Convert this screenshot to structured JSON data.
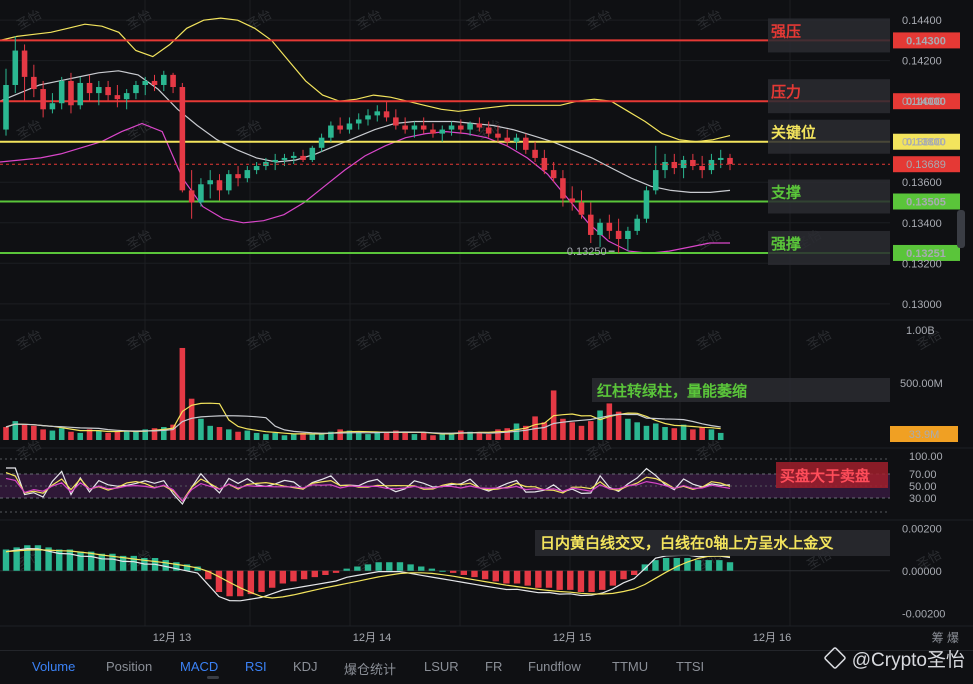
{
  "chart_data": {
    "type": "candlestick",
    "price_axis": {
      "ticks": [
        "0.14400",
        "0.14200",
        "0.14000",
        "0.13800",
        "0.13600",
        "0.13400",
        "0.13200",
        "0.13000"
      ],
      "tick_values": [
        0.144,
        0.142,
        0.14,
        0.138,
        0.136,
        0.134,
        0.132,
        0.13
      ],
      "ylim": [
        0.1293,
        0.1446
      ]
    },
    "x_dates": [
      "12月 13",
      "12月 14",
      "12月 15",
      "12月 16"
    ],
    "ohlc": [
      [
        0.1386,
        0.1416,
        0.1383,
        0.1408
      ],
      [
        0.1408,
        0.1432,
        0.1404,
        0.1425
      ],
      [
        0.1425,
        0.1428,
        0.14,
        0.1412
      ],
      [
        0.1412,
        0.1418,
        0.1402,
        0.1406
      ],
      [
        0.1406,
        0.141,
        0.1392,
        0.1396
      ],
      [
        0.1396,
        0.1404,
        0.1394,
        0.1399
      ],
      [
        0.1399,
        0.1412,
        0.1396,
        0.141
      ],
      [
        0.141,
        0.1414,
        0.1394,
        0.1398
      ],
      [
        0.1398,
        0.1412,
        0.1396,
        0.1409
      ],
      [
        0.1409,
        0.1413,
        0.14,
        0.1404
      ],
      [
        0.1404,
        0.141,
        0.1398,
        0.1407
      ],
      [
        0.1407,
        0.141,
        0.14,
        0.1403
      ],
      [
        0.1403,
        0.1408,
        0.1397,
        0.1401
      ],
      [
        0.1401,
        0.1406,
        0.1396,
        0.1404
      ],
      [
        0.1404,
        0.141,
        0.1401,
        0.1408
      ],
      [
        0.1408,
        0.1412,
        0.1403,
        0.141
      ],
      [
        0.141,
        0.1413,
        0.1405,
        0.1408
      ],
      [
        0.1408,
        0.1415,
        0.1405,
        0.1413
      ],
      [
        0.1413,
        0.1414,
        0.1404,
        0.1407
      ],
      [
        0.1407,
        0.1409,
        0.1355,
        0.1356
      ],
      [
        0.1356,
        0.1366,
        0.1342,
        0.135
      ],
      [
        0.135,
        0.1362,
        0.1348,
        0.1359
      ],
      [
        0.1359,
        0.1366,
        0.1352,
        0.1361
      ],
      [
        0.1361,
        0.1364,
        0.1351,
        0.1356
      ],
      [
        0.1356,
        0.1366,
        0.1354,
        0.1364
      ],
      [
        0.1364,
        0.1368,
        0.1358,
        0.1362
      ],
      [
        0.1362,
        0.1368,
        0.136,
        0.1366
      ],
      [
        0.1366,
        0.137,
        0.1364,
        0.1368
      ],
      [
        0.1368,
        0.1372,
        0.1366,
        0.137
      ],
      [
        0.137,
        0.1374,
        0.1366,
        0.1371
      ],
      [
        0.1371,
        0.1374,
        0.1368,
        0.1372
      ],
      [
        0.1372,
        0.1375,
        0.1369,
        0.1373
      ],
      [
        0.1373,
        0.1376,
        0.137,
        0.1371
      ],
      [
        0.1371,
        0.1378,
        0.137,
        0.1377
      ],
      [
        0.1377,
        0.1384,
        0.1375,
        0.1382
      ],
      [
        0.1382,
        0.139,
        0.138,
        0.1388
      ],
      [
        0.1388,
        0.1392,
        0.1384,
        0.1386
      ],
      [
        0.1386,
        0.1392,
        0.1384,
        0.1389
      ],
      [
        0.1389,
        0.1394,
        0.1386,
        0.1391
      ],
      [
        0.1391,
        0.1396,
        0.1388,
        0.1393
      ],
      [
        0.1393,
        0.1398,
        0.139,
        0.1395
      ],
      [
        0.1395,
        0.14,
        0.139,
        0.1392
      ],
      [
        0.1392,
        0.1396,
        0.1386,
        0.1388
      ],
      [
        0.1388,
        0.1392,
        0.1384,
        0.1386
      ],
      [
        0.1386,
        0.139,
        0.1382,
        0.1388
      ],
      [
        0.1388,
        0.1392,
        0.1384,
        0.1386
      ],
      [
        0.1386,
        0.1389,
        0.1382,
        0.1384
      ],
      [
        0.1384,
        0.1388,
        0.138,
        0.1386
      ],
      [
        0.1386,
        0.139,
        0.1383,
        0.1388
      ],
      [
        0.1388,
        0.1391,
        0.1384,
        0.1386
      ],
      [
        0.1386,
        0.139,
        0.1383,
        0.1389
      ],
      [
        0.1389,
        0.1392,
        0.1385,
        0.1387
      ],
      [
        0.1387,
        0.139,
        0.1382,
        0.1384
      ],
      [
        0.1384,
        0.1388,
        0.138,
        0.1382
      ],
      [
        0.1382,
        0.1386,
        0.1378,
        0.138
      ],
      [
        0.138,
        0.1384,
        0.1376,
        0.1382
      ],
      [
        0.1382,
        0.1384,
        0.1374,
        0.1376
      ],
      [
        0.1376,
        0.138,
        0.137,
        0.1372
      ],
      [
        0.1372,
        0.1376,
        0.1364,
        0.1366
      ],
      [
        0.1366,
        0.137,
        0.136,
        0.1362
      ],
      [
        0.1362,
        0.1366,
        0.1348,
        0.1352
      ],
      [
        0.1352,
        0.1358,
        0.1346,
        0.135
      ],
      [
        0.135,
        0.1356,
        0.1342,
        0.1344
      ],
      [
        0.1344,
        0.135,
        0.133,
        0.1334
      ],
      [
        0.1334,
        0.1342,
        0.1328,
        0.134
      ],
      [
        0.134,
        0.1344,
        0.1332,
        0.1336
      ],
      [
        0.1336,
        0.1342,
        0.1325,
        0.1332
      ],
      [
        0.1332,
        0.1338,
        0.1326,
        0.1336
      ],
      [
        0.1336,
        0.1344,
        0.1334,
        0.1342
      ],
      [
        0.1342,
        0.1358,
        0.134,
        0.1356
      ],
      [
        0.1356,
        0.1378,
        0.1354,
        0.1366
      ],
      [
        0.1366,
        0.1374,
        0.1362,
        0.137
      ],
      [
        0.137,
        0.1374,
        0.1364,
        0.1367
      ],
      [
        0.1367,
        0.1373,
        0.1362,
        0.1371
      ],
      [
        0.1371,
        0.1374,
        0.1366,
        0.1368
      ],
      [
        0.1368,
        0.1373,
        0.1362,
        0.1366
      ],
      [
        0.1366,
        0.1374,
        0.1364,
        0.1371
      ],
      [
        0.1371,
        0.1376,
        0.1367,
        0.1372
      ],
      [
        0.1372,
        0.1374,
        0.1366,
        0.1369
      ]
    ],
    "ma_lines": {
      "upper_band": [
        0.143,
        0.1432,
        0.1433,
        0.1434,
        0.1436,
        0.1438,
        0.1437,
        0.1434,
        0.1425,
        0.1422,
        0.1428,
        0.1436,
        0.144,
        0.1441,
        0.144,
        0.1436,
        0.143,
        0.142,
        0.141,
        0.1403,
        0.14,
        0.1401,
        0.1403,
        0.1402,
        0.14,
        0.1398,
        0.1396,
        0.1395,
        0.1396,
        0.1397,
        0.1398,
        0.1398,
        0.1398,
        0.1398,
        0.14,
        0.1401,
        0.14,
        0.1395,
        0.139,
        0.1384,
        0.1381,
        0.138,
        0.1381,
        0.1383
      ],
      "middle_band": [
        0.14,
        0.1404,
        0.1408,
        0.141,
        0.1412,
        0.1414,
        0.1415,
        0.1413,
        0.1406,
        0.1396,
        0.1388,
        0.1381,
        0.1376,
        0.1372,
        0.137,
        0.1371,
        0.1374,
        0.1378,
        0.1382,
        0.1386,
        0.1389,
        0.139,
        0.139,
        0.139,
        0.1389,
        0.1388,
        0.1386,
        0.1383,
        0.138,
        0.1376,
        0.1372,
        0.1367,
        0.1362,
        0.1358,
        0.1356,
        0.1355,
        0.1355,
        0.1356
      ],
      "lower_band": [
        0.137,
        0.1371,
        0.1372,
        0.1374,
        0.1377,
        0.138,
        0.1385,
        0.1389,
        0.1385,
        0.1362,
        0.1348,
        0.1342,
        0.134,
        0.1341,
        0.1344,
        0.135,
        0.1358,
        0.1366,
        0.1373,
        0.1378,
        0.1382,
        0.1384,
        0.1385,
        0.1384,
        0.1382,
        0.1378,
        0.1372,
        0.1364,
        0.1352,
        0.134,
        0.1331,
        0.1326,
        0.1325,
        0.1326,
        0.1328,
        0.133,
        0.133
      ]
    },
    "levels": [
      {
        "name": "强压",
        "price_label": "0.14300",
        "value": 0.143,
        "color": "#e53935"
      },
      {
        "name": "压力",
        "price_label": "0.14000",
        "value": 0.14,
        "color": "#e53935"
      },
      {
        "name": "关键位",
        "price_label": "0.13800",
        "value": 0.138,
        "color": "#f3e45d"
      },
      {
        "name": "支撑",
        "price_label": "0.13505",
        "value": 0.13505,
        "color": "#5ac53a"
      },
      {
        "name": "强撑",
        "price_label": "0.13251",
        "value": 0.13251,
        "color": "#5ac53a"
      }
    ],
    "current_price": {
      "label": "0.13689",
      "value": 0.13689,
      "color": "#e53935"
    },
    "low_marker": {
      "label": "0.13250",
      "value": 0.1325
    },
    "volume": {
      "axis_ticks": [
        "1.00B",
        "500.00M"
      ],
      "ylim": [
        0,
        1000000000
      ],
      "current_label": "33.9M",
      "values": [
        110,
        160,
        130,
        120,
        90,
        80,
        100,
        70,
        60,
        90,
        80,
        60,
        70,
        80,
        70,
        90,
        100,
        110,
        130,
        780,
        350,
        180,
        120,
        110,
        90,
        70,
        80,
        60,
        50,
        60,
        40,
        50,
        60,
        50,
        60,
        70,
        90,
        80,
        60,
        50,
        60,
        70,
        80,
        60,
        50,
        60,
        40,
        50,
        60,
        80,
        70,
        60,
        50,
        90,
        100,
        140,
        120,
        200,
        150,
        420,
        180,
        150,
        120,
        160,
        250,
        310,
        240,
        180,
        150,
        120,
        140,
        110,
        100,
        130,
        90,
        110,
        90,
        60
      ],
      "unit": "millions"
    },
    "rsi": {
      "axis_ticks": [
        "100.00",
        "70.00",
        "50.00",
        "30.00"
      ],
      "ylim": [
        0,
        100
      ]
    },
    "macd": {
      "axis_ticks": [
        "0.00200",
        "0.00000",
        "-0.00200"
      ],
      "ylim": [
        -0.0026,
        0.0022
      ],
      "hist": [
        0.001,
        0.0011,
        0.0012,
        0.0012,
        0.0011,
        0.001,
        0.001,
        0.0009,
        0.0009,
        0.0008,
        0.0008,
        0.0007,
        0.0007,
        0.0006,
        0.0006,
        0.0005,
        0.0004,
        0.0003,
        0.0002,
        -0.0004,
        -0.001,
        -0.0012,
        -0.0012,
        -0.0011,
        -0.001,
        -0.0008,
        -0.0006,
        -0.0005,
        -0.0004,
        -0.0003,
        -0.0002,
        -0.0001,
        0.0001,
        0.0002,
        0.0003,
        0.0004,
        0.0004,
        0.0004,
        0.0003,
        0.0002,
        0.0001,
        0.0,
        -0.0001,
        -0.0002,
        -0.0003,
        -0.0004,
        -0.0005,
        -0.0006,
        -0.0006,
        -0.0007,
        -0.0008,
        -0.0008,
        -0.0009,
        -0.0009,
        -0.001,
        -0.001,
        -0.0009,
        -0.0007,
        -0.0004,
        -0.0002,
        0.0003,
        0.0005,
        0.0006,
        0.0006,
        0.0006,
        0.0005,
        0.0005,
        0.0005,
        0.0004
      ]
    },
    "annotations": {
      "volume": "红柱转绿柱，量能萎缩",
      "rsi": "买盘大于卖盘",
      "macd": "日内黄白线交叉，白线在0轴上方呈水上金叉"
    },
    "watermark": "圣怡"
  },
  "tabs": [
    "Volume",
    "Position",
    "MACD",
    "RSI",
    "KDJ",
    "爆仓统计",
    "LSUR",
    "FR",
    "Fundflow",
    "TTMU",
    "TTSI"
  ],
  "active_tabs": [
    "Volume",
    "MACD",
    "RSI"
  ],
  "corner_label": "筹 爆",
  "brand": "@Crypto圣怡",
  "colors": {
    "up": "#2bb791",
    "down": "#e53945",
    "bg": "#0f1013",
    "grid": "#1c1e22"
  }
}
